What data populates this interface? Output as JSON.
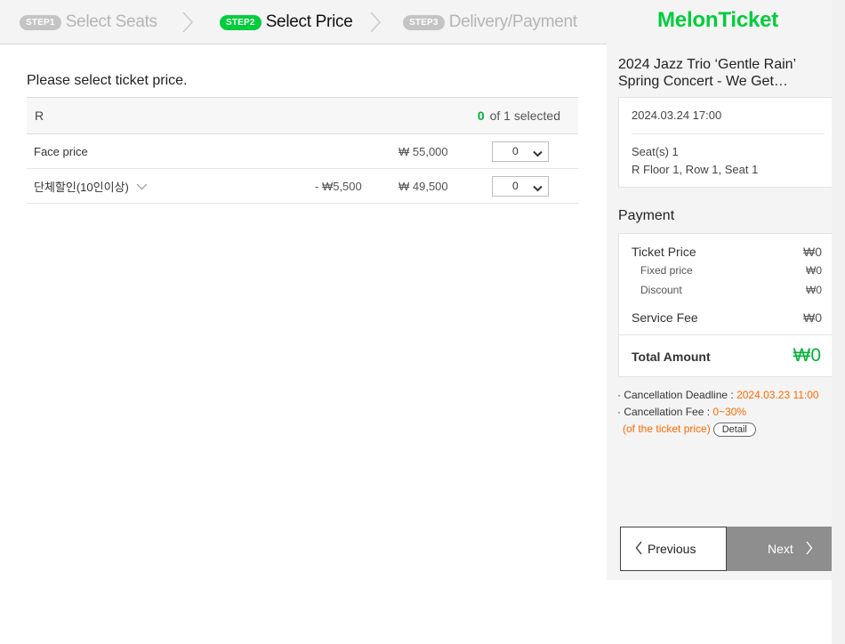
{
  "steps": [
    {
      "badge": "STEP1",
      "label": "Select Seats",
      "active": false
    },
    {
      "badge": "STEP2",
      "label": "Select Price",
      "active": true
    },
    {
      "badge": "STEP3",
      "label": "Delivery/Payment",
      "active": false
    }
  ],
  "main": {
    "instruction": "Please select ticket price.",
    "grade": {
      "name": "R",
      "selected_count": "0",
      "selected_suffix": "of 1 selected"
    },
    "prices": [
      {
        "name": "Face price",
        "discount": "",
        "amount": "₩ 55,000",
        "qty": "0"
      },
      {
        "name": "단체할인(10인이상)",
        "discount": "- ₩5,500",
        "amount": "₩ 49,500",
        "qty": "0"
      }
    ]
  },
  "side": {
    "logo": "MelonTicket",
    "show_title": "2024 Jazz Trio ‘Gentle Rain’ Spring Concert - We Get…",
    "datetime": "2024.03.24 17:00",
    "seats_label": "Seat(s) 1",
    "seat_detail": "R Floor 1, Row 1, Seat 1",
    "payment_heading": "Payment",
    "payment": {
      "ticket_price_label": "Ticket Price",
      "ticket_price": "₩0",
      "fixed_price_label": "Fixed price",
      "fixed_price": "₩0",
      "discount_label": "Discount",
      "discount": "₩0",
      "service_fee_label": "Service Fee",
      "service_fee": "₩0",
      "total_label": "Total Amount",
      "total": "₩0"
    },
    "notes": {
      "deadline_label": "· Cancellation Deadline : ",
      "deadline_value": "2024.03.23 11:00",
      "fee_label": "· Cancellation Fee : ",
      "fee_value": "0~30%",
      "fee_note": "(of the ticket price)",
      "detail_button": "Detail"
    },
    "buttons": {
      "previous": "Previous",
      "next": "Next"
    }
  },
  "colors": {
    "brand_green": "#00cd3c",
    "highlight_orange": "#ff6a00",
    "next_button_gray": "#8e8e8e"
  }
}
